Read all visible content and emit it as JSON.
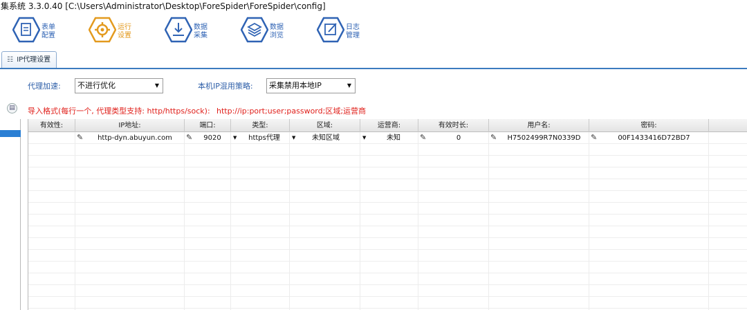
{
  "window": {
    "title": "集系统   3.3.0.40   [C:\\Users\\Administrator\\Desktop\\ForeSpider\\ForeSpider\\config]"
  },
  "toolbar": {
    "items": [
      {
        "label": "表单\n配置",
        "icon": "form-icon"
      },
      {
        "label": "运行\n设置",
        "icon": "gear-icon",
        "active": true
      },
      {
        "label": "数据\n采集",
        "icon": "download-icon"
      },
      {
        "label": "数据\n浏览",
        "icon": "layers-icon"
      },
      {
        "label": "日志\n管理",
        "icon": "edit-icon"
      }
    ],
    "accent_color": "#2f63b4",
    "active_color": "#e39a1e"
  },
  "tab": {
    "label": "IP代理设置",
    "icon": "proxy-icon"
  },
  "settings": {
    "accel_label": "代理加速:",
    "accel_value": "不进行优化",
    "strategy_label": "本机IP混用策略:",
    "strategy_value": "采集禁用本地IP"
  },
  "notice": {
    "format": "导入格式(每行一个, 代理类型支持: http/https/sock):",
    "pattern": "http://ip:port;user;password;区域;运营商",
    "color": "#e0201b"
  },
  "table": {
    "headers": [
      "有效性:",
      "IP地址:",
      "端口:",
      "类型:",
      "区域:",
      "运营商:",
      "有效时长:",
      "用户名:",
      "密码:"
    ],
    "rows": [
      {
        "valid": "",
        "ip": "http-dyn.abuyun.com",
        "port": "9020",
        "type": "https代理",
        "region": "未知区域",
        "isp": "未知",
        "duration": "0",
        "username": "H7502499R7N0339D",
        "password": "00F1433416D72BD7"
      }
    ]
  }
}
